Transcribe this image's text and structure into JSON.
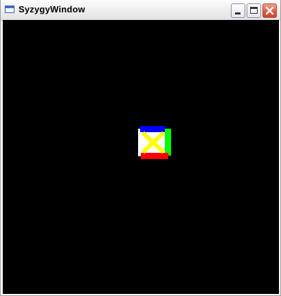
{
  "window": {
    "title": "SyzygyWindow",
    "icon": "window-app-icon",
    "controls": {
      "minimize_icon": "minimize-icon",
      "maximize_icon": "maximize-icon",
      "close_icon": "close-icon"
    }
  },
  "scene": {
    "background_color": "#000000",
    "object": {
      "face_color": "#ffffff",
      "cross_color": "#ffff00",
      "top_color": "#0000ff",
      "right_color": "#00ff00",
      "bottom_color": "#ff0000"
    }
  }
}
